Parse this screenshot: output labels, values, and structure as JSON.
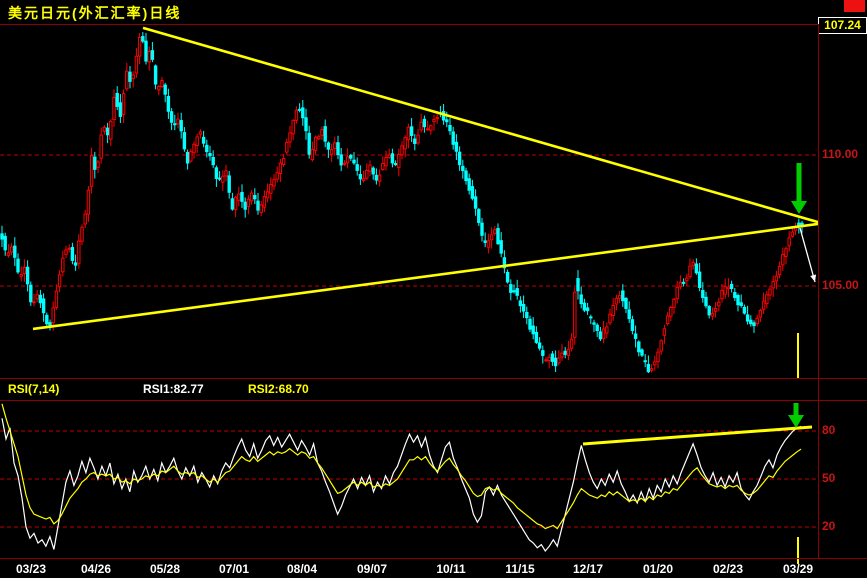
{
  "window": {
    "title": "美元日元(外汇汇率)日线",
    "latest_price": "107.24"
  },
  "rsi_panel": {
    "indicator_label": "RSI(7,14)",
    "rsi1_label": "RSI1:82.77",
    "rsi2_label": "RSI2:68.70"
  },
  "colors": {
    "background": "#000000",
    "border": "#8b0000",
    "grid": "#c00000",
    "axis_text": "#c81414",
    "up_candle": "#ff0000",
    "down_candle": "#00ffff",
    "trendline": "#ffff00",
    "rsi1": "#ffffff",
    "rsi2": "#ffff00",
    "arrow": "#00cc00",
    "white_arrow": "#ffffff",
    "marker": "#ffff00",
    "title_text": "#ffff00",
    "date_text": "#ffffff"
  },
  "chart_data": [
    {
      "type": "candlestick",
      "title": "美元日元(外汇汇率)日线",
      "ylim": [
        101.4,
        115.0
      ],
      "last_price": 107.24,
      "gridlines": [
        {
          "value": 110.0,
          "label": "110.00"
        },
        {
          "value": 105.0,
          "label": "105.00"
        }
      ],
      "price_path": [
        [
          2,
          107.1
        ],
        [
          8,
          106.1
        ],
        [
          14,
          106.6
        ],
        [
          20,
          105.3
        ],
        [
          26,
          105.8
        ],
        [
          33,
          104.2
        ],
        [
          40,
          104.8
        ],
        [
          46,
          103.7
        ],
        [
          52,
          103.5
        ],
        [
          58,
          104.9
        ],
        [
          64,
          106.1
        ],
        [
          70,
          106.6
        ],
        [
          76,
          105.6
        ],
        [
          82,
          107.1
        ],
        [
          88,
          108.0
        ],
        [
          93,
          110.0
        ],
        [
          98,
          109.2
        ],
        [
          104,
          111.3
        ],
        [
          110,
          110.6
        ],
        [
          116,
          112.3
        ],
        [
          122,
          111.5
        ],
        [
          128,
          113.2
        ],
        [
          133,
          112.7
        ],
        [
          138,
          113.8
        ],
        [
          143,
          114.8
        ],
        [
          147,
          113.5
        ],
        [
          152,
          114.1
        ],
        [
          158,
          112.4
        ],
        [
          163,
          112.9
        ],
        [
          169,
          111.8
        ],
        [
          175,
          111.0
        ],
        [
          181,
          111.4
        ],
        [
          188,
          109.7
        ],
        [
          194,
          110.3
        ],
        [
          201,
          110.9
        ],
        [
          208,
          110.2
        ],
        [
          214,
          109.7
        ],
        [
          220,
          108.9
        ],
        [
          227,
          109.4
        ],
        [
          233,
          107.9
        ],
        [
          240,
          108.6
        ],
        [
          247,
          108.0
        ],
        [
          253,
          108.6
        ],
        [
          260,
          107.8
        ],
        [
          266,
          108.4
        ],
        [
          272,
          108.8
        ],
        [
          280,
          109.4
        ],
        [
          287,
          110.2
        ],
        [
          294,
          111.2
        ],
        [
          300,
          111.9
        ],
        [
          306,
          111.2
        ],
        [
          311,
          109.9
        ],
        [
          317,
          110.6
        ],
        [
          324,
          111.0
        ],
        [
          330,
          110.1
        ],
        [
          337,
          110.4
        ],
        [
          344,
          109.5
        ],
        [
          351,
          110.0
        ],
        [
          357,
          109.5
        ],
        [
          364,
          109.0
        ],
        [
          371,
          109.6
        ],
        [
          377,
          108.9
        ],
        [
          384,
          109.6
        ],
        [
          390,
          110.0
        ],
        [
          397,
          109.6
        ],
        [
          404,
          110.3
        ],
        [
          410,
          111.0
        ],
        [
          416,
          110.4
        ],
        [
          423,
          111.3
        ],
        [
          429,
          110.9
        ],
        [
          436,
          111.5
        ],
        [
          443,
          111.6
        ],
        [
          448,
          111.2
        ],
        [
          452,
          110.8
        ],
        [
          456,
          110.3
        ],
        [
          460,
          109.8
        ],
        [
          464,
          109.4
        ],
        [
          468,
          109.0
        ],
        [
          472,
          108.6
        ],
        [
          476,
          108.2
        ],
        [
          480,
          107.4
        ],
        [
          484,
          106.8
        ],
        [
          488,
          106.5
        ],
        [
          492,
          106.9
        ],
        [
          496,
          107.2
        ],
        [
          500,
          106.6
        ],
        [
          504,
          105.9
        ],
        [
          508,
          105.3
        ],
        [
          512,
          104.7
        ],
        [
          516,
          104.9
        ],
        [
          520,
          104.4
        ],
        [
          524,
          104.2
        ],
        [
          528,
          103.8
        ],
        [
          532,
          103.4
        ],
        [
          536,
          103.1
        ],
        [
          540,
          102.6
        ],
        [
          544,
          102.3
        ],
        [
          548,
          102.1
        ],
        [
          552,
          102.4
        ],
        [
          556,
          102.0
        ],
        [
          560,
          102.2
        ],
        [
          564,
          102.6
        ],
        [
          568,
          102.3
        ],
        [
          572,
          102.7
        ],
        [
          575,
          103.5
        ],
        [
          577,
          105.6
        ],
        [
          580,
          104.6
        ],
        [
          584,
          104.2
        ],
        [
          590,
          103.9
        ],
        [
          596,
          103.4
        ],
        [
          602,
          103.0
        ],
        [
          608,
          103.5
        ],
        [
          614,
          104.2
        ],
        [
          620,
          104.8
        ],
        [
          626,
          104.4
        ],
        [
          632,
          103.5
        ],
        [
          638,
          102.8
        ],
        [
          644,
          102.2
        ],
        [
          650,
          101.8
        ],
        [
          656,
          102.0
        ],
        [
          662,
          102.9
        ],
        [
          668,
          103.7
        ],
        [
          674,
          104.4
        ],
        [
          680,
          105.0
        ],
        [
          686,
          105.2
        ],
        [
          692,
          105.7
        ],
        [
          696,
          106.0
        ],
        [
          700,
          105.0
        ],
        [
          706,
          104.4
        ],
        [
          712,
          103.8
        ],
        [
          718,
          104.3
        ],
        [
          724,
          104.8
        ],
        [
          730,
          105.0
        ],
        [
          736,
          104.6
        ],
        [
          742,
          104.2
        ],
        [
          748,
          103.8
        ],
        [
          754,
          103.5
        ],
        [
          760,
          103.9
        ],
        [
          766,
          104.4
        ],
        [
          772,
          104.9
        ],
        [
          778,
          105.5
        ],
        [
          784,
          106.1
        ],
        [
          790,
          106.7
        ],
        [
          795,
          107.2
        ],
        [
          799,
          107.5
        ],
        [
          802,
          107.2
        ]
      ],
      "trendlines": {
        "descending": [
          [
            143,
            114.85
          ],
          [
            818,
            107.44
          ]
        ],
        "ascending": [
          [
            33,
            103.36
          ],
          [
            818,
            107.37
          ]
        ]
      }
    },
    {
      "type": "line",
      "title": "RSI(7,14)",
      "ylim": [
        0,
        100
      ],
      "gridlines": [
        {
          "value": 80,
          "label": "80"
        },
        {
          "value": 50,
          "label": "50"
        },
        {
          "value": 20,
          "label": "20"
        }
      ],
      "x_span": [
        2,
        801
      ],
      "series": [
        {
          "name": "RSI1",
          "current": 82.77,
          "values": [
            88,
            75,
            82,
            60,
            52,
            38,
            20,
            13,
            16,
            10,
            12,
            8,
            14,
            6,
            20,
            34,
            48,
            55,
            46,
            52,
            61,
            54,
            63,
            57,
            50,
            58,
            52,
            60,
            47,
            53,
            44,
            50,
            42,
            55,
            48,
            52,
            58,
            50,
            56,
            49,
            60,
            54,
            58,
            63,
            55,
            50,
            57,
            52,
            58,
            48,
            54,
            50,
            45,
            52,
            47,
            55,
            60,
            57,
            64,
            70,
            75,
            68,
            64,
            72,
            63,
            68,
            74,
            77,
            71,
            76,
            70,
            74,
            78,
            73,
            68,
            74,
            70,
            65,
            72,
            60,
            55,
            48,
            42,
            35,
            28,
            33,
            40,
            45,
            50,
            44,
            51,
            46,
            52,
            42,
            48,
            44,
            52,
            47,
            54,
            58,
            65,
            72,
            78,
            73,
            77,
            70,
            76,
            65,
            58,
            54,
            62,
            70,
            73,
            63,
            57,
            50,
            44,
            38,
            28,
            23,
            27,
            42,
            45,
            40,
            46,
            40,
            36,
            32,
            28,
            24,
            20,
            16,
            12,
            10,
            7,
            9,
            5,
            8,
            12,
            8,
            18,
            28,
            38,
            48,
            60,
            71,
            62,
            54,
            48,
            44,
            50,
            46,
            53,
            48,
            55,
            47,
            42,
            36,
            40,
            35,
            42,
            36,
            44,
            38,
            46,
            42,
            50,
            45,
            52,
            47,
            54,
            60,
            66,
            72,
            65,
            57,
            52,
            48,
            54,
            46,
            51,
            45,
            52,
            48,
            54,
            44,
            40,
            37,
            42,
            46,
            52,
            58,
            62,
            57,
            65,
            70,
            74,
            77,
            80,
            82,
            82.8
          ]
        },
        {
          "name": "RSI2",
          "current": 68.7,
          "values": [
            97,
            88,
            80,
            72,
            64,
            52,
            40,
            32,
            28,
            27,
            26,
            25,
            26,
            22,
            24,
            28,
            33,
            38,
            41,
            44,
            48,
            50,
            53,
            54,
            52,
            53,
            52,
            53,
            50,
            51,
            48,
            49,
            47,
            50,
            49,
            50,
            52,
            51,
            53,
            52,
            55,
            54,
            56,
            58,
            55,
            53,
            54,
            53,
            54,
            51,
            52,
            50,
            48,
            50,
            48,
            51,
            54,
            55,
            58,
            61,
            64,
            62,
            61,
            64,
            61,
            63,
            65,
            67,
            65,
            67,
            66,
            67,
            69,
            67,
            65,
            67,
            66,
            63,
            64,
            60,
            57,
            53,
            49,
            45,
            41,
            42,
            44,
            46,
            48,
            46,
            48,
            46,
            48,
            45,
            46,
            45,
            47,
            46,
            48,
            50,
            54,
            58,
            62,
            62,
            64,
            62,
            64,
            60,
            57,
            55,
            58,
            61,
            63,
            59,
            56,
            52,
            49,
            45,
            41,
            39,
            40,
            44,
            45,
            43,
            44,
            41,
            39,
            37,
            35,
            32,
            30,
            28,
            26,
            24,
            22,
            21,
            19,
            20,
            21,
            19,
            23,
            27,
            31,
            35,
            40,
            44,
            42,
            40,
            39,
            38,
            40,
            39,
            42,
            40,
            42,
            40,
            38,
            36,
            37,
            36,
            38,
            36,
            39,
            37,
            40,
            39,
            42,
            41,
            44,
            43,
            46,
            49,
            52,
            55,
            57,
            53,
            50,
            47,
            46,
            45,
            46,
            44,
            46,
            45,
            46,
            43,
            41,
            40,
            41,
            43,
            46,
            49,
            52,
            51,
            55,
            58,
            61,
            63,
            65,
            67,
            68.7
          ]
        }
      ],
      "trendline": [
        [
          583,
          71.9
        ],
        [
          812,
          82.5
        ]
      ]
    }
  ],
  "x_axis": {
    "labels": [
      "03/23",
      "04/26",
      "05/28",
      "07/01",
      "08/04",
      "09/07",
      "10/11",
      "11/15",
      "12/17",
      "01/20",
      "02/23",
      "03/29"
    ],
    "positions": [
      31,
      96,
      165,
      234,
      302,
      372,
      451,
      520,
      588,
      658,
      728,
      798
    ]
  },
  "annotations": {
    "main_green_arrow": {
      "x": 799,
      "y_top": 138,
      "y_bottom": 189
    },
    "rsi_green_arrow": {
      "x": 796,
      "y_top": 2,
      "y_bottom": 27
    },
    "white_arrow": {
      "from": [
        800,
        203
      ],
      "to": [
        815,
        257
      ]
    },
    "main_marker": {
      "x": 798,
      "y1": 308,
      "y2": 353
    },
    "rsi_marker": {
      "x": 798,
      "y1": 136,
      "y2": 157
    }
  }
}
